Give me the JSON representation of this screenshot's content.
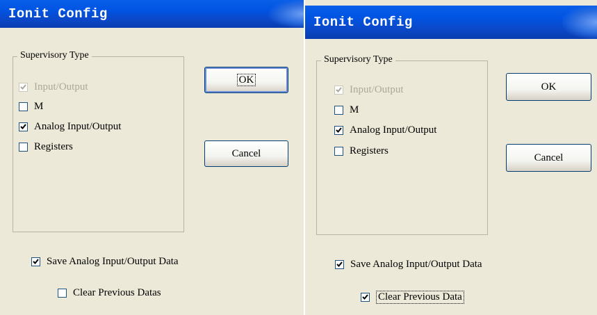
{
  "dialogs": [
    {
      "title": "Ionit Config",
      "group_label": "Supervisory Type",
      "options": [
        {
          "label": "Input/Output",
          "checked": true,
          "disabled": true
        },
        {
          "label": "M",
          "checked": false,
          "disabled": false
        },
        {
          "label": "Analog Input/Output",
          "checked": true,
          "disabled": false
        },
        {
          "label": "Registers",
          "checked": false,
          "disabled": false
        }
      ],
      "ok_label": "OK",
      "cancel_label": "Cancel",
      "save_label": "Save Analog Input/Output Data",
      "save_checked": true,
      "clear_label": "Clear Previous Datas",
      "clear_checked": false
    },
    {
      "title": "Ionit Config",
      "group_label": "Supervisory Type",
      "options": [
        {
          "label": "Input/Output",
          "checked": true,
          "disabled": true
        },
        {
          "label": "M",
          "checked": false,
          "disabled": false
        },
        {
          "label": "Analog Input/Output",
          "checked": true,
          "disabled": false
        },
        {
          "label": "Registers",
          "checked": false,
          "disabled": false
        }
      ],
      "ok_label": "OK",
      "cancel_label": "Cancel",
      "save_label": "Save Analog Input/Output Data",
      "save_checked": true,
      "clear_label": "Clear Previous Data",
      "clear_checked": true
    }
  ],
  "colors": {
    "titlebar": "#0054E3",
    "dialog_bg": "#ECE9D8",
    "button_border": "#003C74",
    "checkbox_border": "#1C5180"
  }
}
